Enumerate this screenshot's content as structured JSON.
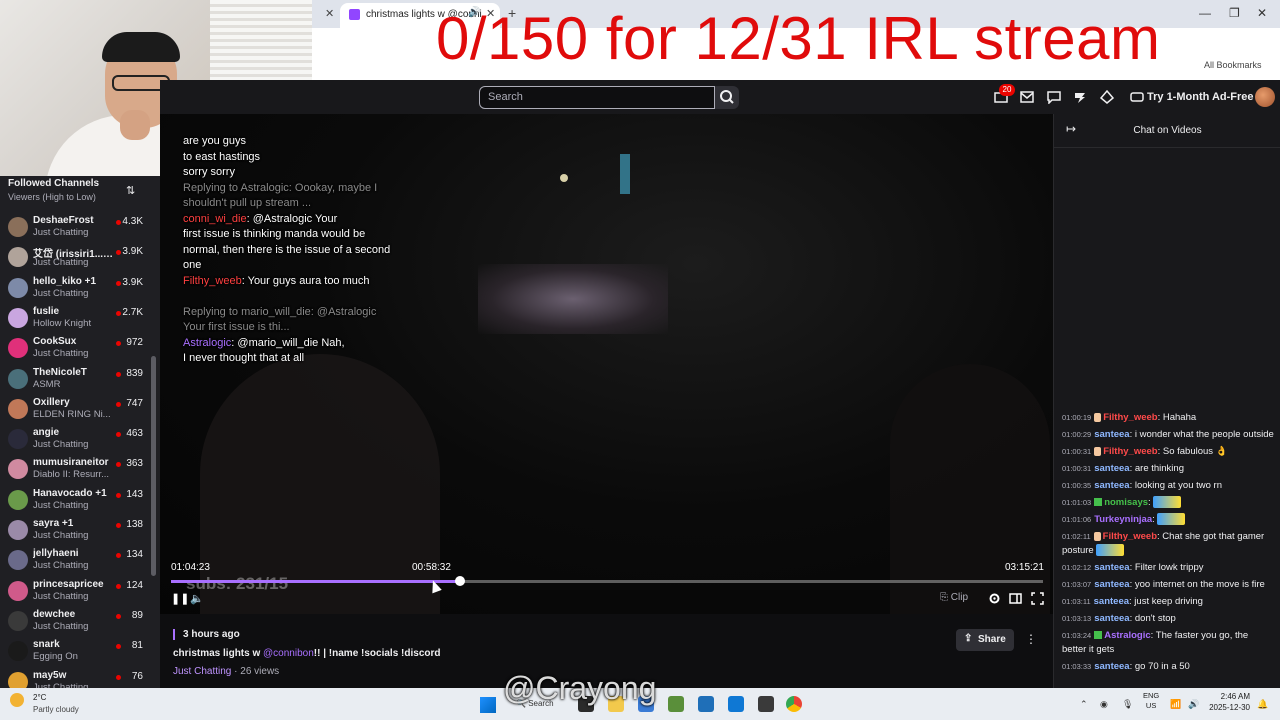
{
  "browser": {
    "tab_title": "christmas lights w @conni",
    "bookmarks_label": "All Bookmarks"
  },
  "overlay": {
    "banner": "0/150 for 12/31 IRL stream",
    "subs": "subs: 231/15",
    "watermark": "@Crayong"
  },
  "topnav": {
    "search_placeholder": "Search",
    "notifications_count": "20",
    "try_ad_free": "Try 1-Month Ad-Free"
  },
  "sidebar": {
    "title": "Followed Channels",
    "sort": "Viewers (High to Low)",
    "channels": [
      {
        "name": "DeshaeFrost",
        "game": "Just Chatting",
        "viewers": "4.3K",
        "color": "#8a6f5a"
      },
      {
        "name": "艾岱 (irissiri1... +1",
        "game": "Just Chatting",
        "viewers": "3.9K",
        "color": "#b0a39a"
      },
      {
        "name": "hello_kiko +1",
        "game": "Just Chatting",
        "viewers": "3.9K",
        "color": "#7d8aa8"
      },
      {
        "name": "fuslie",
        "game": "Hollow Knight",
        "viewers": "2.7K",
        "color": "#c9a6e0"
      },
      {
        "name": "CookSux",
        "game": "Just Chatting",
        "viewers": "972",
        "color": "#e0307a"
      },
      {
        "name": "TheNicoleT",
        "game": "ASMR",
        "viewers": "839",
        "color": "#4a6f7a"
      },
      {
        "name": "Oxillery",
        "game": "ELDEN RING Ni...",
        "viewers": "747",
        "color": "#c07858"
      },
      {
        "name": "angie",
        "game": "Just Chatting",
        "viewers": "463",
        "color": "#2a2a3a"
      },
      {
        "name": "mumusiraneitor",
        "game": "Diablo II: Resurr...",
        "viewers": "363",
        "color": "#d08aa0"
      },
      {
        "name": "Hanavocado +1",
        "game": "Just Chatting",
        "viewers": "143",
        "color": "#6a9a4a"
      },
      {
        "name": "sayra +1",
        "game": "Just Chatting",
        "viewers": "138",
        "color": "#9a8aa8"
      },
      {
        "name": "jellyhaeni",
        "game": "Just Chatting",
        "viewers": "134",
        "color": "#6a6a8a"
      },
      {
        "name": "princesapricee",
        "game": "Just Chatting",
        "viewers": "124",
        "color": "#d05a8a"
      },
      {
        "name": "dewchee",
        "game": "Just Chatting",
        "viewers": "89",
        "color": "#3a3a3a"
      },
      {
        "name": "snark",
        "game": "Egging On",
        "viewers": "81",
        "color": "#1a1a1a"
      },
      {
        "name": "may5w",
        "game": "Just Chatting",
        "viewers": "76",
        "color": "#e0a030"
      }
    ]
  },
  "video_chat_overlay": {
    "l1": "are you guys",
    "l2": "to east hastings",
    "l3": "sorry sorry",
    "l4": "Replying to Astralogic: Oookay, maybe I",
    "l5": "shouldn't pull up stream ...",
    "l6a": "conni_wi_die",
    "l6b": ": @Astralogic Your",
    "l7": "first issue is thinking manda would be",
    "l8": "normal, then there is the issue of a second",
    "l9": "one",
    "l10a": "Filthy_weeb",
    "l10b": ": Your guys aura too much",
    "l11": "Replying to mario_will_die: @Astralogic",
    "l12": "Your first issue is thi...",
    "l13a": "Astralogic",
    "l13b": ": @mario_will_die Nah,",
    "l14": "I never thought that at all"
  },
  "player": {
    "time_elapsed": "01:04:23",
    "time_hover": "00:58:32",
    "time_total": "03:15:21",
    "progress": 0.331,
    "hover_position": 0.3,
    "clip_label": "Clip"
  },
  "video_info": {
    "posted": "3 hours ago",
    "title_a": "christmas lights w ",
    "title_mention": "@connibon",
    "title_b": "!! | !name !socials !discord",
    "category": "Just Chatting",
    "views": " · 26 views",
    "share_label": "Share"
  },
  "chat": {
    "title": "Chat on Videos",
    "messages": [
      {
        "ts": "01:00:19",
        "user": "Filthy_weeb",
        "color": "#ff4a4a",
        "text": ": Hahaha"
      },
      {
        "ts": "01:00:29",
        "user": "santeea",
        "color": "#8fb8ff",
        "text": ": i wonder what the people outside"
      },
      {
        "ts": "01:00:31",
        "user": "Filthy_weeb",
        "color": "#ff4a4a",
        "text": ": So fabulous 👌"
      },
      {
        "ts": "01:00:31",
        "user": "santeea",
        "color": "#8fb8ff",
        "text": ": are thinking"
      },
      {
        "ts": "01:00:35",
        "user": "santeea",
        "color": "#8fb8ff",
        "text": ": looking at you two rn"
      },
      {
        "ts": "01:01:03",
        "user": "nomisays",
        "color": "#45c04a",
        "text": ":"
      },
      {
        "ts": "01:01:06",
        "user": "Turkeyninjaa",
        "color": "#a970ff",
        "text": ":"
      },
      {
        "ts": "01:02:11",
        "user": "Filthy_weeb",
        "color": "#ff4a4a",
        "text": ": Chat she got that gamer posture"
      },
      {
        "ts": "01:02:12",
        "user": "santeea",
        "color": "#8fb8ff",
        "text": ": Filter lowk trippy"
      },
      {
        "ts": "01:03:07",
        "user": "santeea",
        "color": "#8fb8ff",
        "text": ": yoo internet on the move is fire"
      },
      {
        "ts": "01:03:11",
        "user": "santeea",
        "color": "#8fb8ff",
        "text": ": just keep driving"
      },
      {
        "ts": "01:03:13",
        "user": "santeea",
        "color": "#8fb8ff",
        "text": ": don't stop"
      },
      {
        "ts": "01:03:24",
        "user": "Astralogic",
        "color": "#a970ff",
        "text": ": The faster you go, the better it gets"
      },
      {
        "ts": "01:03:33",
        "user": "santeea",
        "color": "#8fb8ff",
        "text": ": go 70 in a 50"
      }
    ]
  },
  "taskbar": {
    "temp": "2°C",
    "condition": "Partly cloudy",
    "search": "Search",
    "lang1": "ENG",
    "lang2": "US",
    "time": "2:46 AM",
    "date": "2025-12-30"
  }
}
